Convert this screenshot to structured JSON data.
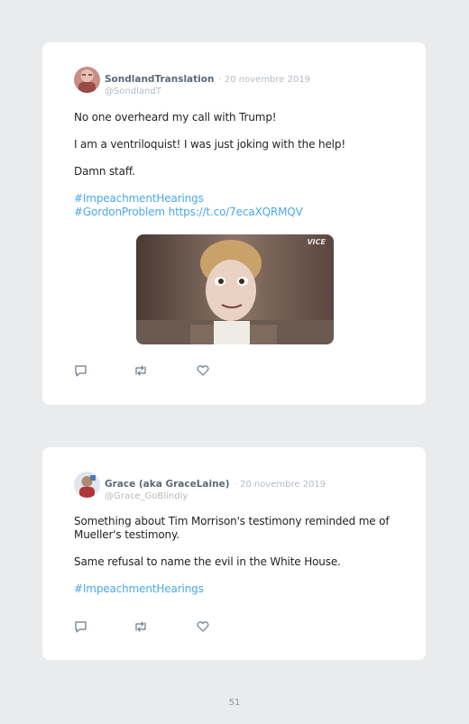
{
  "tweets": [
    {
      "name": "SondlandTranslation",
      "date": "· 20 novembre 2019",
      "handle": "@SondlandT",
      "paragraphs": [
        "No one overheard my call with Trump!",
        "I am a ventriloquist! I was just joking with the help!",
        "Damn staff."
      ],
      "tags": [
        "#ImpeachmentHearings",
        "#GordonProblem https://t.co/7ecaXQRMQV"
      ],
      "media_watermark": "VICE"
    },
    {
      "name": "Grace (aka GraceLaine)",
      "date": "· 20 novembre 2019",
      "handle": "@Grace_GoBlindly",
      "paragraphs": [
        "Something about Tim Morrison's testimony reminded me of Mueller's testimony.",
        "Same refusal to name the evil in the White House."
      ],
      "tags": [
        "#ImpeachmentHearings"
      ]
    }
  ],
  "page_number": "51",
  "icons": {
    "reply": "speech-bubble-icon",
    "retweet": "retweet-arrows-icon",
    "like": "heart-icon"
  },
  "colors": {
    "background": "#e9ebed",
    "card": "#ffffff",
    "name": "#5b6977",
    "meta": "#b4bcc4",
    "link": "#4aa8e8",
    "icon": "#6b7785"
  }
}
